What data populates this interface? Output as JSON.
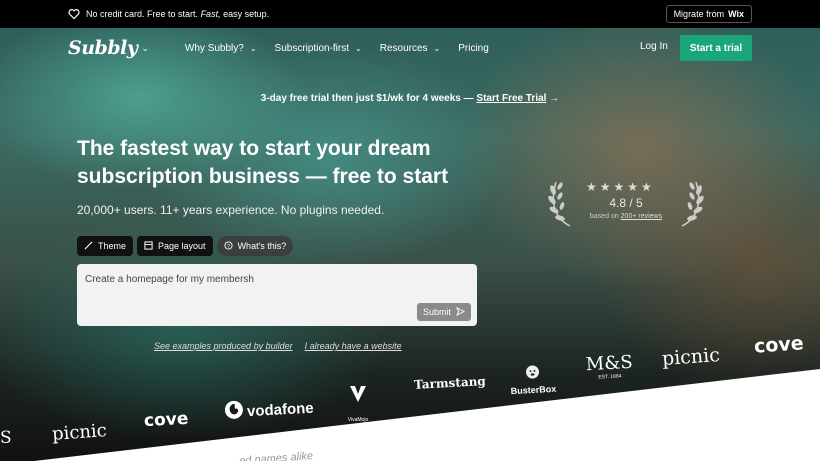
{
  "topbar": {
    "message_prefix": "No credit card. Free to start.",
    "message_fast": "Fast,",
    "message_suffix": "easy setup.",
    "migrate_label": "Migrate from",
    "migrate_brand": "Wix"
  },
  "nav": {
    "logo": "Subbly",
    "items": [
      "Why Subbly?",
      "Subscription-first",
      "Resources",
      "Pricing"
    ],
    "login": "Log In",
    "cta": "Start a trial"
  },
  "promo": {
    "text": "3-day free trial then just $1/wk for 4 weeks —",
    "link": "Start Free Trial",
    "arrow": "→"
  },
  "hero": {
    "headline": "The fastest way to start your dream subscription business — free to start",
    "subline": "20,000+ users. 11+ years experience. No plugins needed.",
    "chips": [
      "Theme",
      "Page layout",
      "What's this?"
    ],
    "prompt_value": "Create a homepage for my membersh",
    "submit": "Submit",
    "link_examples": "See examples produced by builder",
    "link_website": "I already have a website"
  },
  "rating": {
    "stars": "★★★★★",
    "score": "4.8 / 5",
    "based_prefix": "based on",
    "based_link": "200+ reviews"
  },
  "brands": {
    "row_top": [
      "Tarmstang",
      "BusterBox",
      "M&S",
      "picnic",
      "cove"
    ],
    "ms_sub": "EST. 1884",
    "vivamojo": "VivaMojo",
    "row_bottom": [
      "S",
      "picnic",
      "cove",
      "vodafone"
    ]
  },
  "bottom": {
    "text": "...ed names alike"
  },
  "colors": {
    "accent": "#1aa57a",
    "topbar_bg": "#000000",
    "prompt_bg": "#f2f2f2"
  }
}
